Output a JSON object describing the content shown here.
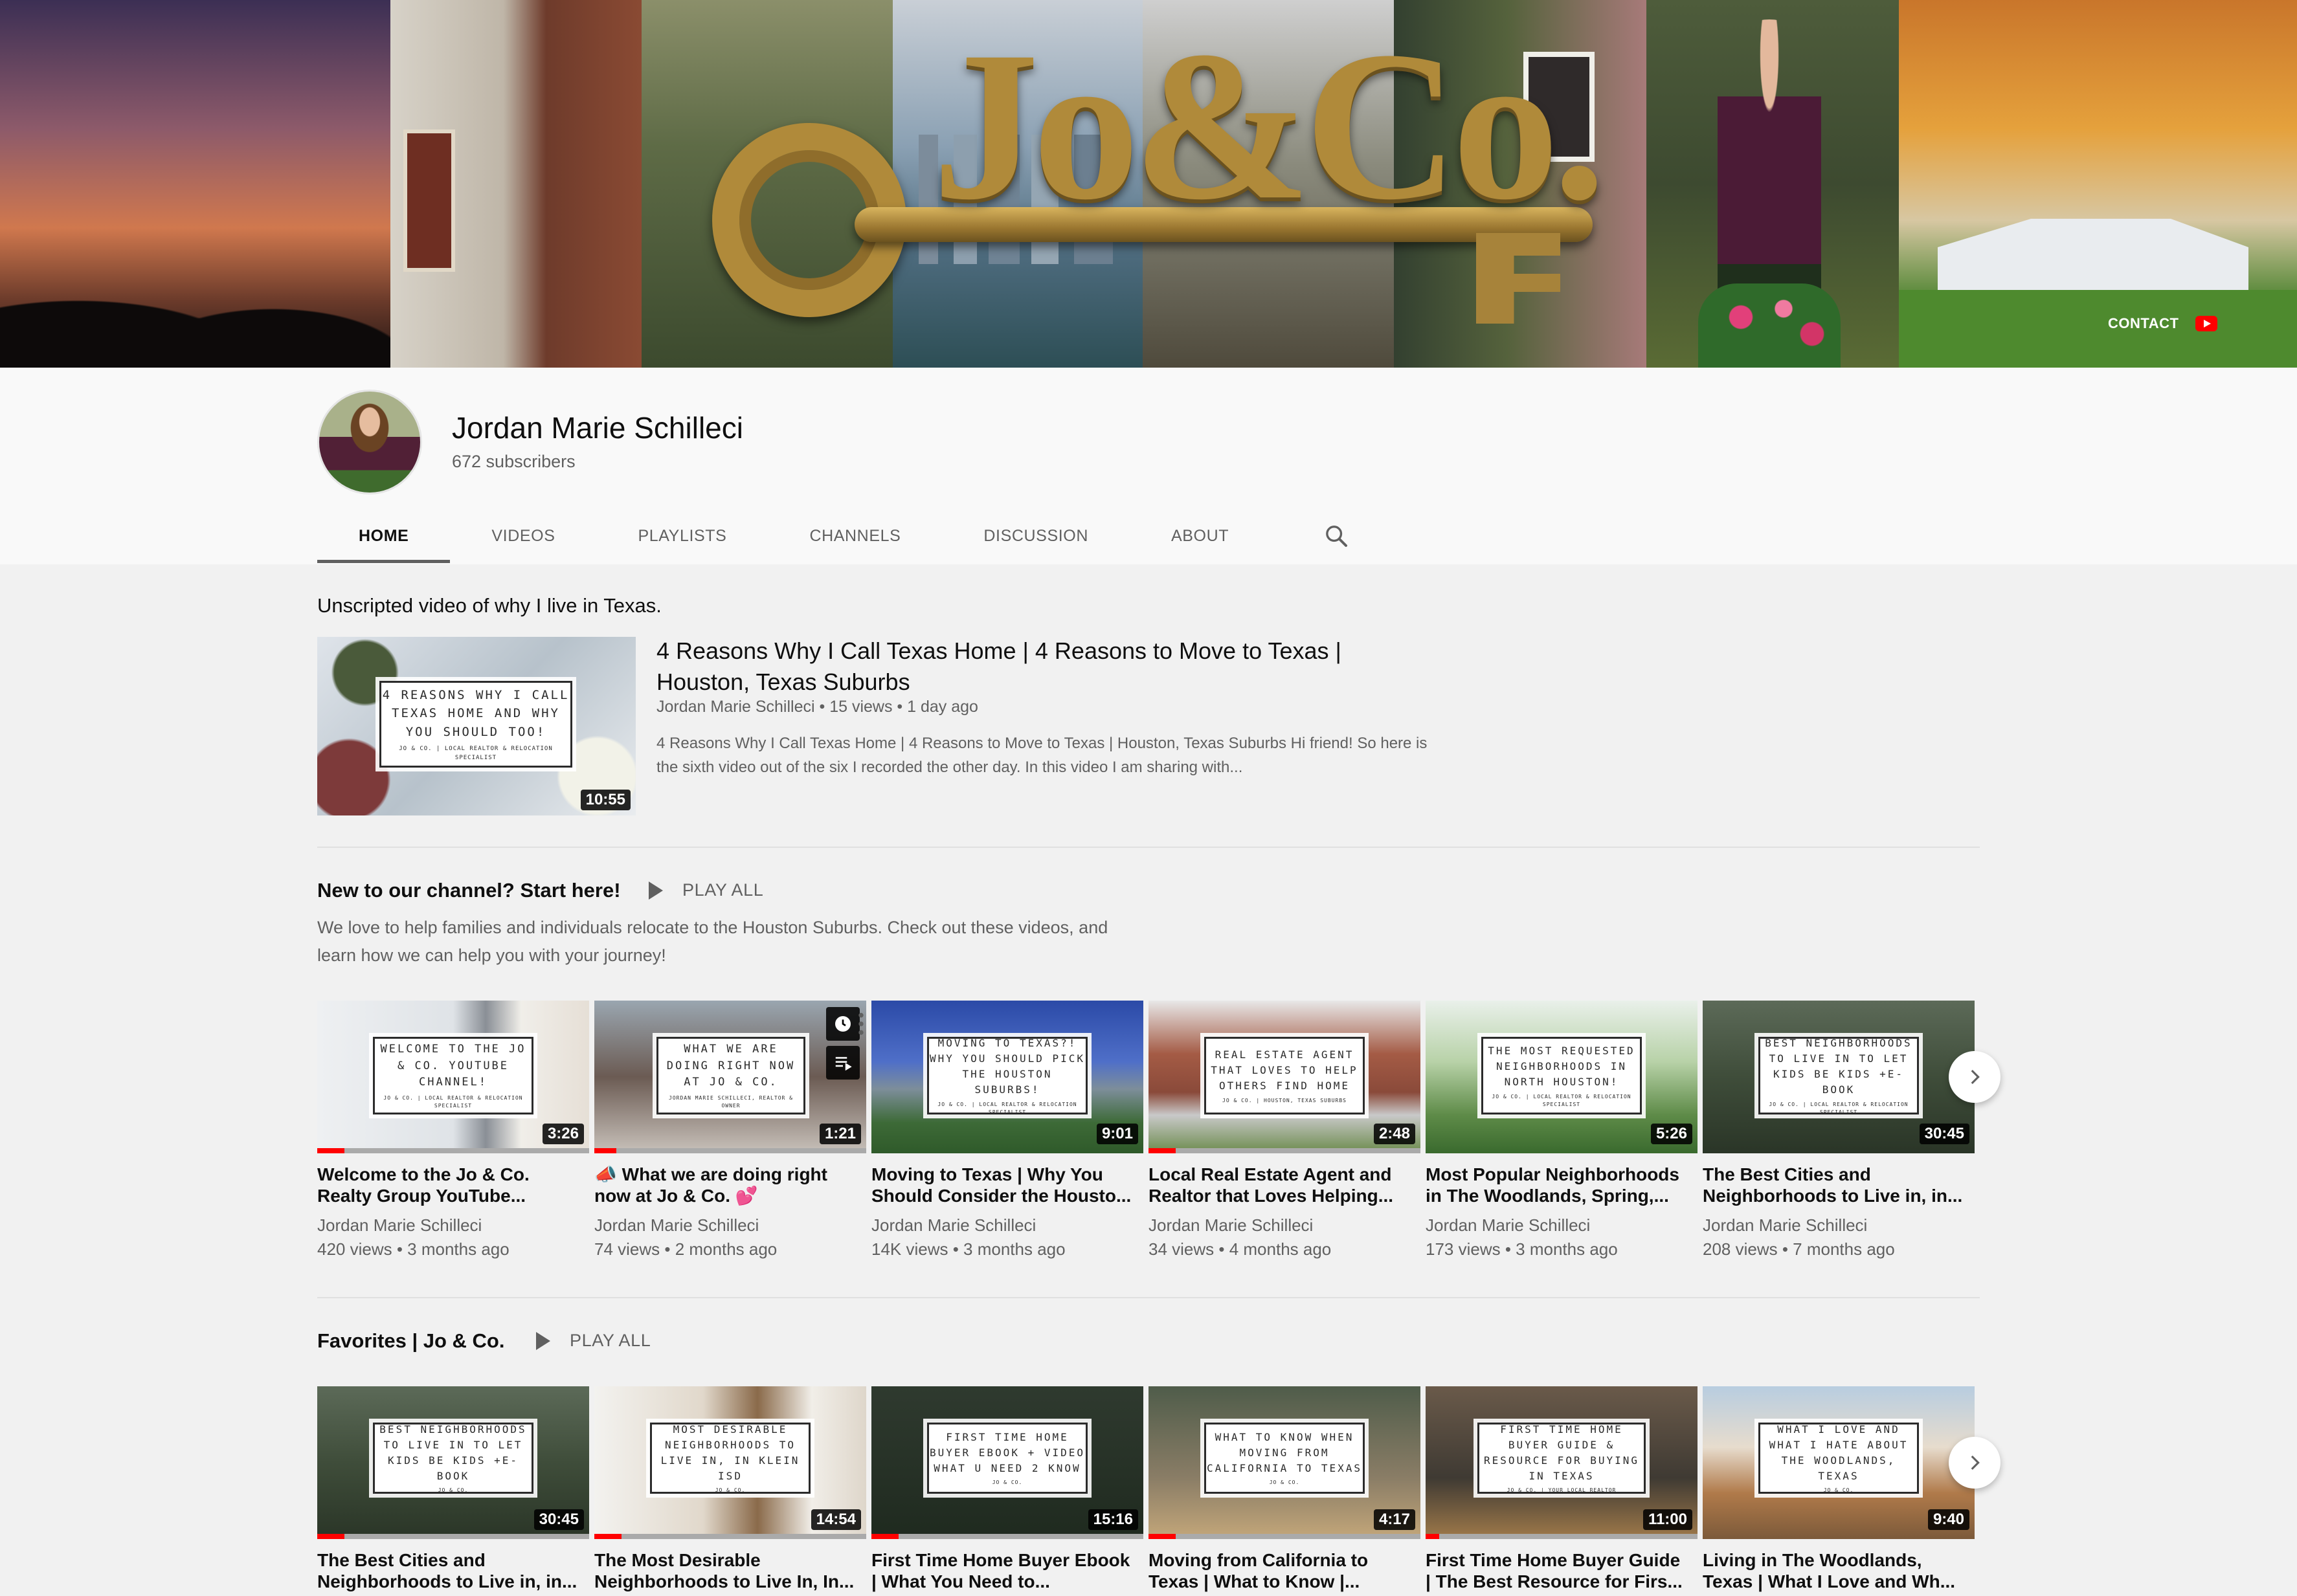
{
  "banner": {
    "logo_text": "Jo&Co.",
    "contact_label": "CONTACT"
  },
  "channel": {
    "name": "Jordan Marie Schilleci",
    "subscribers": "672 subscribers"
  },
  "tabs": [
    {
      "label": "HOME",
      "active": true
    },
    {
      "label": "VIDEOS"
    },
    {
      "label": "PLAYLISTS"
    },
    {
      "label": "CHANNELS"
    },
    {
      "label": "DISCUSSION"
    },
    {
      "label": "ABOUT"
    }
  ],
  "featured": {
    "section_label": "Unscripted video of why I live in Texas.",
    "thumb_text": "4 REASONS WHY I CALL TEXAS HOME AND WHY YOU SHOULD TOO!",
    "thumb_sub": "JO & CO. | LOCAL REALTOR & RELOCATION SPECIALIST",
    "duration": "10:55",
    "title": "4 Reasons Why I Call Texas Home | 4 Reasons to Move to Texas | Houston, Texas Suburbs",
    "meta": "Jordan Marie Schilleci • 15 views • 1 day ago",
    "description": "4 Reasons Why I Call Texas Home | 4 Reasons to Move to Texas | Houston, Texas Suburbs Hi friend! So here is the sixth video out of the six I recorded the other day. In this video I am sharing with..."
  },
  "shelf1": {
    "title": "New to our channel? Start here!",
    "play_all": "PLAY ALL",
    "description": "We love to help families and individuals relocate to the Houston Suburbs. Check out these videos, and learn how we can help you with your journey!",
    "videos": [
      {
        "thumb_text": "WELCOME TO THE JO & CO. YOUTUBE CHANNEL!",
        "thumb_sub": "JO & CO. | LOCAL REALTOR & RELOCATION SPECIALIST",
        "duration": "3:26",
        "title": "Welcome to the Jo & Co. Realty Group YouTube...",
        "channel": "Jordan Marie Schilleci",
        "meta": "420 views • 3 months ago",
        "progress": 0.1
      },
      {
        "thumb_text": "WHAT WE ARE DOING RIGHT NOW AT JO & CO.",
        "thumb_sub": "JORDAN MARIE SCHILLECI, REALTOR & OWNER",
        "duration": "1:21",
        "title": "📣 What we are doing right now at Jo & Co. 💕",
        "channel": "Jordan Marie Schilleci",
        "meta": "74 views • 2 months ago",
        "progress": 0.08
      },
      {
        "thumb_text": "MOVING TO TEXAS?! WHY YOU SHOULD PICK THE HOUSTON SUBURBS!",
        "thumb_sub": "JO & CO. | LOCAL REALTOR & RELOCATION SPECIALIST",
        "duration": "9:01",
        "title": "Moving to Texas | Why You Should Consider the Housto...",
        "channel": "Jordan Marie Schilleci",
        "meta": "14K views • 3 months ago",
        "progress": 0
      },
      {
        "thumb_text": "REAL ESTATE AGENT THAT LOVES TO HELP OTHERS FIND HOME",
        "thumb_sub": "JO & CO. | HOUSTON, TEXAS SUBURBS",
        "duration": "2:48",
        "title": "Local Real Estate Agent and Realtor that Loves Helping...",
        "channel": "Jordan Marie Schilleci",
        "meta": "34 views • 4 months ago",
        "progress": 0.1
      },
      {
        "thumb_text": "THE MOST REQUESTED NEIGHBORHOODS IN NORTH HOUSTON!",
        "thumb_sub": "JO & CO. | LOCAL REALTOR & RELOCATION SPECIALIST",
        "duration": "5:26",
        "title": "Most Popular Neighborhoods in The Woodlands, Spring,...",
        "channel": "Jordan Marie Schilleci",
        "meta": "173 views • 3 months ago",
        "progress": 0
      },
      {
        "thumb_text": "BEST NEIGHBORHOODS TO LIVE IN TO LET KIDS BE KIDS +E-BOOK",
        "thumb_sub": "JO & CO. | LOCAL REALTOR & RELOCATION SPECIALIST",
        "duration": "30:45",
        "title": "The Best Cities and Neighborhoods to Live in, in...",
        "channel": "Jordan Marie Schilleci",
        "meta": "208 views • 7 months ago",
        "progress": 0
      }
    ]
  },
  "shelf2": {
    "title": "Favorites | Jo & Co.",
    "play_all": "PLAY ALL",
    "videos": [
      {
        "thumb_text": "BEST NEIGHBORHOODS TO LIVE IN TO LET KIDS BE KIDS +E-BOOK",
        "thumb_sub": "JO & CO.",
        "duration": "30:45",
        "title": "The Best Cities and Neighborhoods to Live in, in...",
        "progress": 0.1
      },
      {
        "thumb_text": "MOST DESIRABLE NEIGHBORHOODS TO LIVE IN, IN KLEIN ISD",
        "thumb_sub": "JO & CO.",
        "duration": "14:54",
        "title": "The Most Desirable Neighborhoods to Live In, In...",
        "progress": 0.1
      },
      {
        "thumb_text": "FIRST TIME HOME BUYER EBOOK + VIDEO WHAT U NEED 2 KNOW",
        "thumb_sub": "JO & CO.",
        "duration": "15:16",
        "title": "First Time Home Buyer Ebook | What You Need to...",
        "progress": 0.1
      },
      {
        "thumb_text": "WHAT TO KNOW WHEN MOVING FROM CALIFORNIA TO TEXAS",
        "thumb_sub": "JO & CO.",
        "duration": "4:17",
        "title": "Moving from California to Texas | What to Know |...",
        "progress": 0.1
      },
      {
        "thumb_text": "FIRST TIME HOME BUYER GUIDE & RESOURCE FOR BUYING IN TEXAS",
        "thumb_sub": "JO & CO. | YOUR LOCAL REALTOR",
        "duration": "11:00",
        "title": "First Time Home Buyer Guide | The Best Resource for Firs...",
        "progress": 0.05
      },
      {
        "thumb_text": "WHAT I LOVE AND WHAT I HATE ABOUT THE WOODLANDS, TEXAS",
        "thumb_sub": "JO & CO.",
        "duration": "9:40",
        "title": "Living in The Woodlands, Texas | What I Love and Wh...",
        "progress": 0
      }
    ]
  }
}
